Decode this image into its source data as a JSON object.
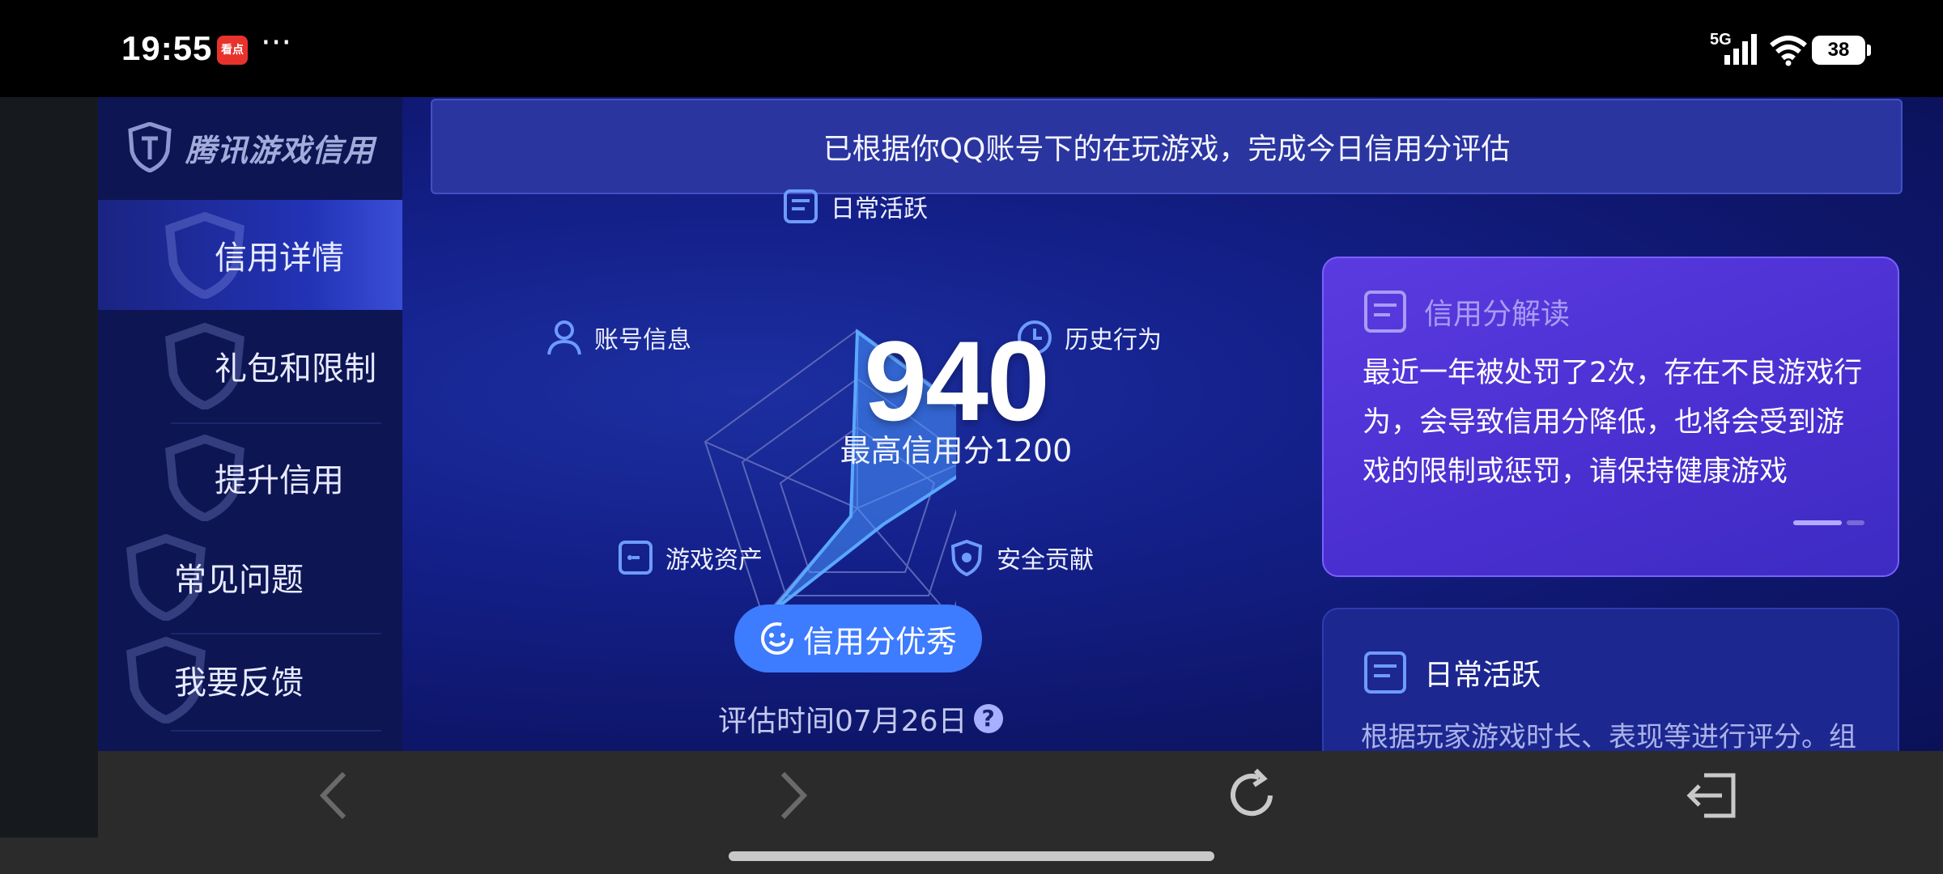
{
  "status_bar": {
    "time": "19:55",
    "app_icon_text": "看点",
    "more": "···",
    "network": "5G",
    "battery": "38"
  },
  "sidebar": {
    "brand": "腾讯游戏信用",
    "items": [
      {
        "label": "信用详情",
        "active": true
      },
      {
        "label": "礼包和限制",
        "active": false
      },
      {
        "label": "提升信用",
        "active": false
      },
      {
        "label": "常见问题",
        "active": false
      },
      {
        "label": "我要反馈",
        "active": false
      }
    ]
  },
  "banner": "已根据你QQ账号下的在玩游戏，完成今日信用分评估",
  "radar": {
    "labels": {
      "daily": "日常活跃",
      "history": "历史行为",
      "safety": "安全贡献",
      "assets": "游戏资产",
      "account": "账号信息"
    },
    "score": "940",
    "max": "最高信用分1200",
    "status": "信用分优秀",
    "eval_time": "评估时间07月26日",
    "help": "?"
  },
  "card_interpretation": {
    "title": "信用分解读",
    "body": "最近一年被处罚了2次，存在不良游戏行为，会导致信用分降低，也将会受到游戏的限制或惩罚，请保持健康游戏"
  },
  "card_daily": {
    "title": "日常活跃",
    "body": "根据玩家游戏时长、表现等进行评分。组"
  },
  "colors": {
    "accent_blue": "#3d7bff",
    "card_purple": "#5a3be0",
    "app_bg": "#14208a"
  }
}
